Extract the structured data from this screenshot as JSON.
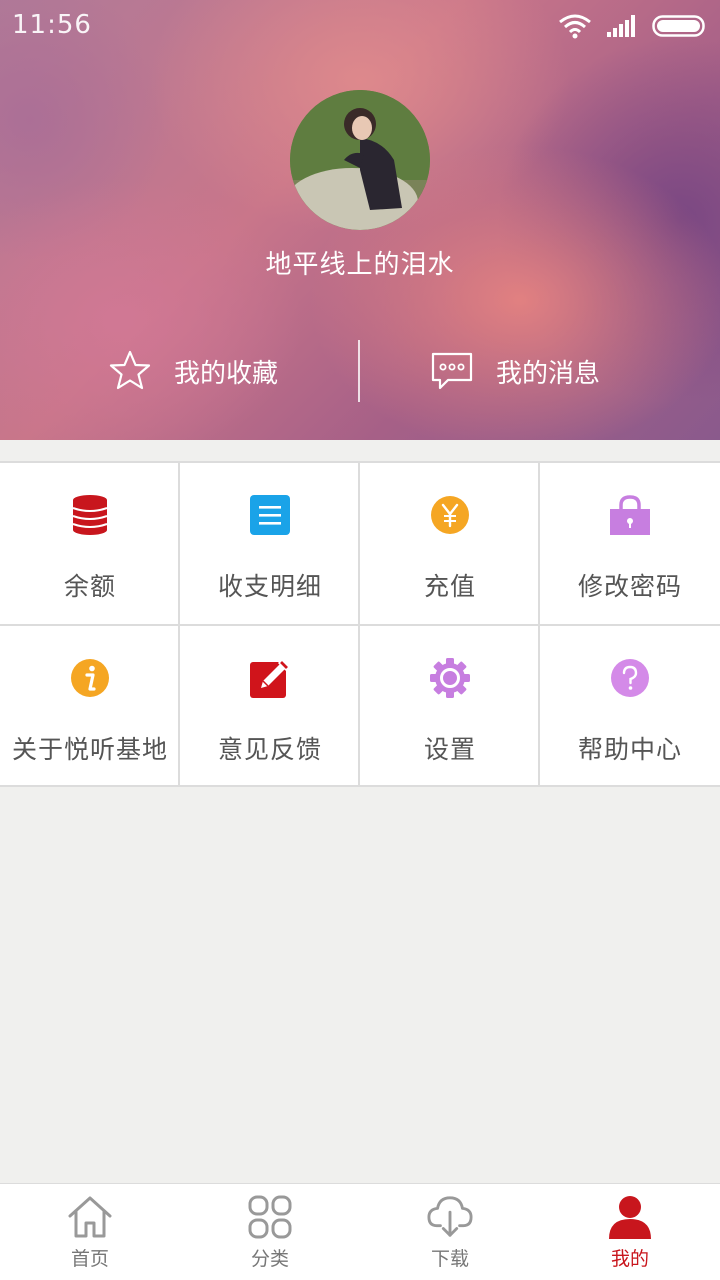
{
  "status_bar": {
    "time": "11:56"
  },
  "profile": {
    "username": "地平线上的泪水"
  },
  "quick_actions": {
    "favorites": {
      "label": "我的收藏",
      "icon": "star-outline-icon"
    },
    "messages": {
      "label": "我的消息",
      "icon": "chat-bubble-icon"
    }
  },
  "grid": {
    "items": [
      {
        "label": "余额",
        "icon": "coin-stack-icon",
        "color": "#c8161d"
      },
      {
        "label": "收支明细",
        "icon": "list-icon",
        "color": "#1aa3e8"
      },
      {
        "label": "充值",
        "icon": "yuan-coin-icon",
        "color": "#f5a623"
      },
      {
        "label": "修改密码",
        "icon": "lock-icon",
        "color": "#c77ee0"
      },
      {
        "label": "关于悦听基地",
        "icon": "info-icon",
        "color": "#f5a623"
      },
      {
        "label": "意见反馈",
        "icon": "edit-icon",
        "color": "#d0141b"
      },
      {
        "label": "设置",
        "icon": "gear-icon",
        "color": "#c77ee0"
      },
      {
        "label": "帮助中心",
        "icon": "help-icon",
        "color": "#d48ae8"
      }
    ]
  },
  "bottom_nav": {
    "items": [
      {
        "label": "首页",
        "icon": "home-icon"
      },
      {
        "label": "分类",
        "icon": "category-icon"
      },
      {
        "label": "下载",
        "icon": "cloud-download-icon"
      },
      {
        "label": "我的",
        "icon": "user-icon",
        "active": true
      }
    ],
    "active_color": "#c8161d",
    "inactive_color": "#999999"
  }
}
